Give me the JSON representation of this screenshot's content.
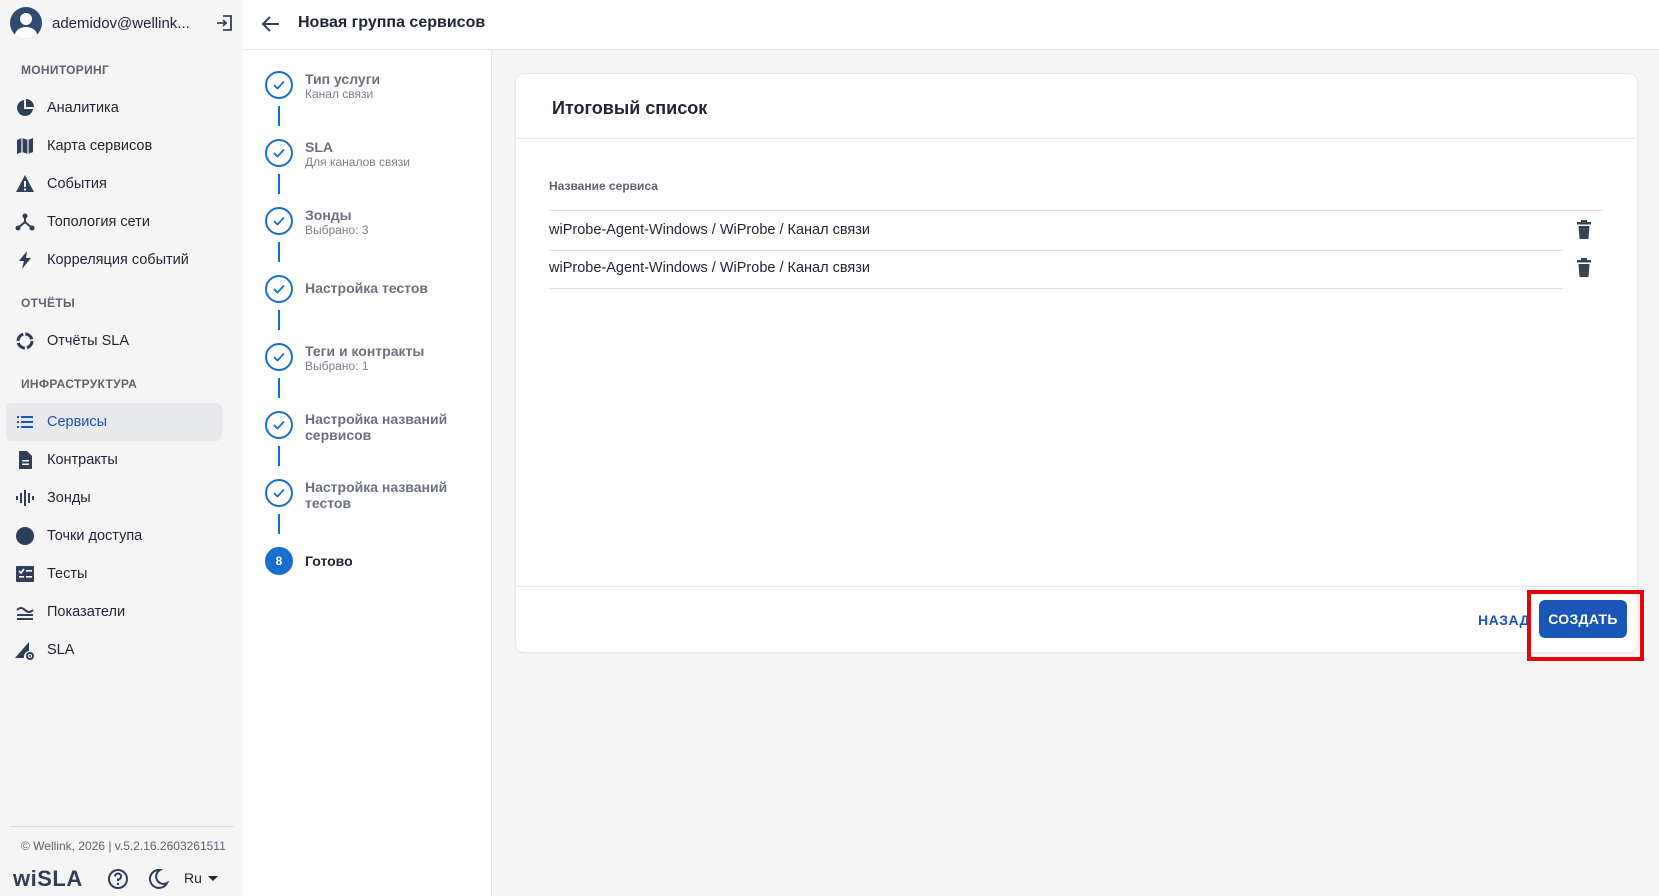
{
  "user": {
    "name": "ademidov@wellink..."
  },
  "sidebar": {
    "sections": [
      {
        "title": "МОНИТОРИНГ"
      },
      {
        "title": "ОТЧЁТЫ"
      },
      {
        "title": "ИНФРАСТРУКТУРА"
      }
    ],
    "items": [
      {
        "label": "Аналитика",
        "icon": "pie-chart-icon"
      },
      {
        "label": "Карта сервисов",
        "icon": "map-icon"
      },
      {
        "label": "События",
        "icon": "warning-icon"
      },
      {
        "label": "Топология сети",
        "icon": "topology-icon"
      },
      {
        "label": "Корреляция событий",
        "icon": "lightning-icon"
      },
      {
        "label": "Отчёты SLA",
        "icon": "ring-chart-icon"
      },
      {
        "label": "Сервисы",
        "icon": "list-icon",
        "active": true
      },
      {
        "label": "Контракты",
        "icon": "document-icon"
      },
      {
        "label": "Зонды",
        "icon": "probe-icon"
      },
      {
        "label": "Точки доступа",
        "icon": "circle-icon"
      },
      {
        "label": "Тесты",
        "icon": "checklist-icon"
      },
      {
        "label": "Показатели",
        "icon": "metrics-icon"
      },
      {
        "label": "SLA",
        "icon": "sla-settings-icon"
      }
    ],
    "footer": {
      "copyright": "© Wellink, 2026 | v.5.2.16.2603261511",
      "logo": "wiSLA",
      "language": "Ru"
    }
  },
  "header": {
    "title": "Новая группа сервисов"
  },
  "steps": [
    {
      "title": "Тип услуги",
      "subtitle": "Канал связи"
    },
    {
      "title": "SLA",
      "subtitle": "Для каналов связи"
    },
    {
      "title": "Зонды",
      "subtitle": "Выбрано: 3"
    },
    {
      "title": "Настройка тестов",
      "subtitle": ""
    },
    {
      "title": "Теги и контракты",
      "subtitle": "Выбрано: 1"
    },
    {
      "title": "Настройка названий сервисов",
      "subtitle": ""
    },
    {
      "title": "Настройка названий тестов",
      "subtitle": ""
    },
    {
      "title": "Готово",
      "subtitle": "",
      "number": "8",
      "current": true
    }
  ],
  "card": {
    "title": "Итоговый список",
    "column_header": "Название сервиса",
    "rows": [
      {
        "name": "wiProbe-Agent-Windows / WiProbe / Канал связи"
      },
      {
        "name": "wiProbe-Agent-Windows / WiProbe / Канал связи"
      }
    ],
    "back_label": "НАЗАД",
    "create_label": "СОЗДАТЬ"
  },
  "colors": {
    "accent": "#1a56b8",
    "step": "#1a6dd0",
    "highlight": "#e8000a"
  }
}
